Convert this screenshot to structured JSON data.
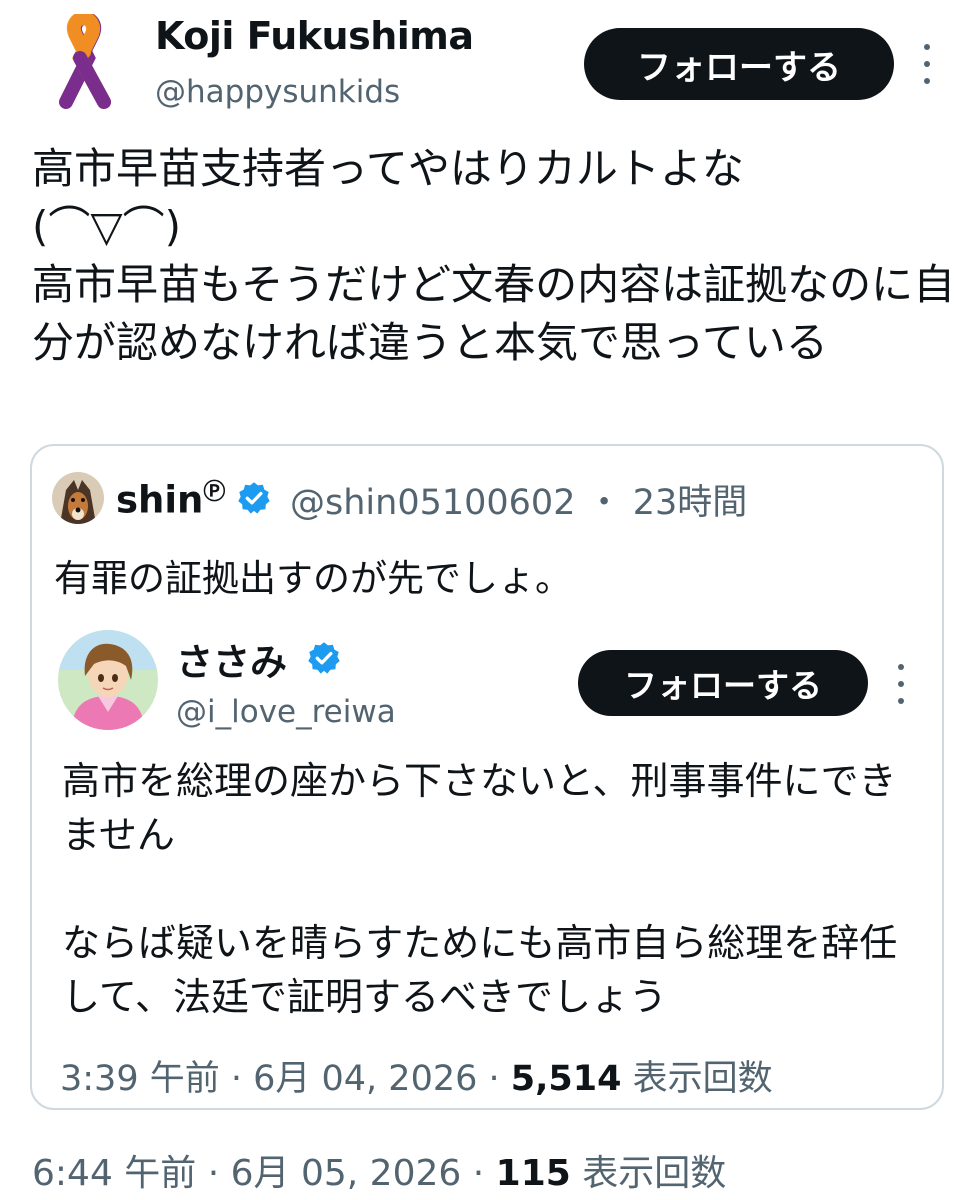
{
  "author": {
    "name": "Koji Fukushima",
    "handle": "@happysunkids",
    "avatar_icon": "awareness-ribbon-icon",
    "ribbon_colors": [
      "#f7941d",
      "#7b2d8e"
    ]
  },
  "follow_label": "フォローする",
  "more_icon": "more-options-icon",
  "tweet": {
    "text": "高市早苗支持者ってやはりカルトよな\n(⌒▽⌒)\n高市早苗もそうだけど文春の内容は証拠なのに自分が認めなければ違うと本気で思っている"
  },
  "quote": {
    "name": "shin",
    "name_suffix": "Ⓟ",
    "handle": "@shin05100602",
    "separator": "・",
    "time_ago": "23時間",
    "text": "有罪の証拠出すのが先でしょ。",
    "verified_icon": "verified-badge-icon",
    "verified_color": "#1d9bf0",
    "nested": {
      "name": "ささみ",
      "handle": "@i_love_reiwa",
      "text": "高市を総理の座から下さないと、刑事事件にできません\n\nならば疑いを晴らすためにも高市自ら総理を辞任して、法廷で証明するべきでしょう",
      "time": "3:39 午前",
      "date": "6月 04, 2026",
      "views_count": "5,514",
      "views_label": "表示回数"
    }
  },
  "meta": {
    "time": "6:44 午前",
    "date": "6月 05, 2026",
    "views_count": "115",
    "views_label": "表示回数",
    "separator": " · "
  }
}
